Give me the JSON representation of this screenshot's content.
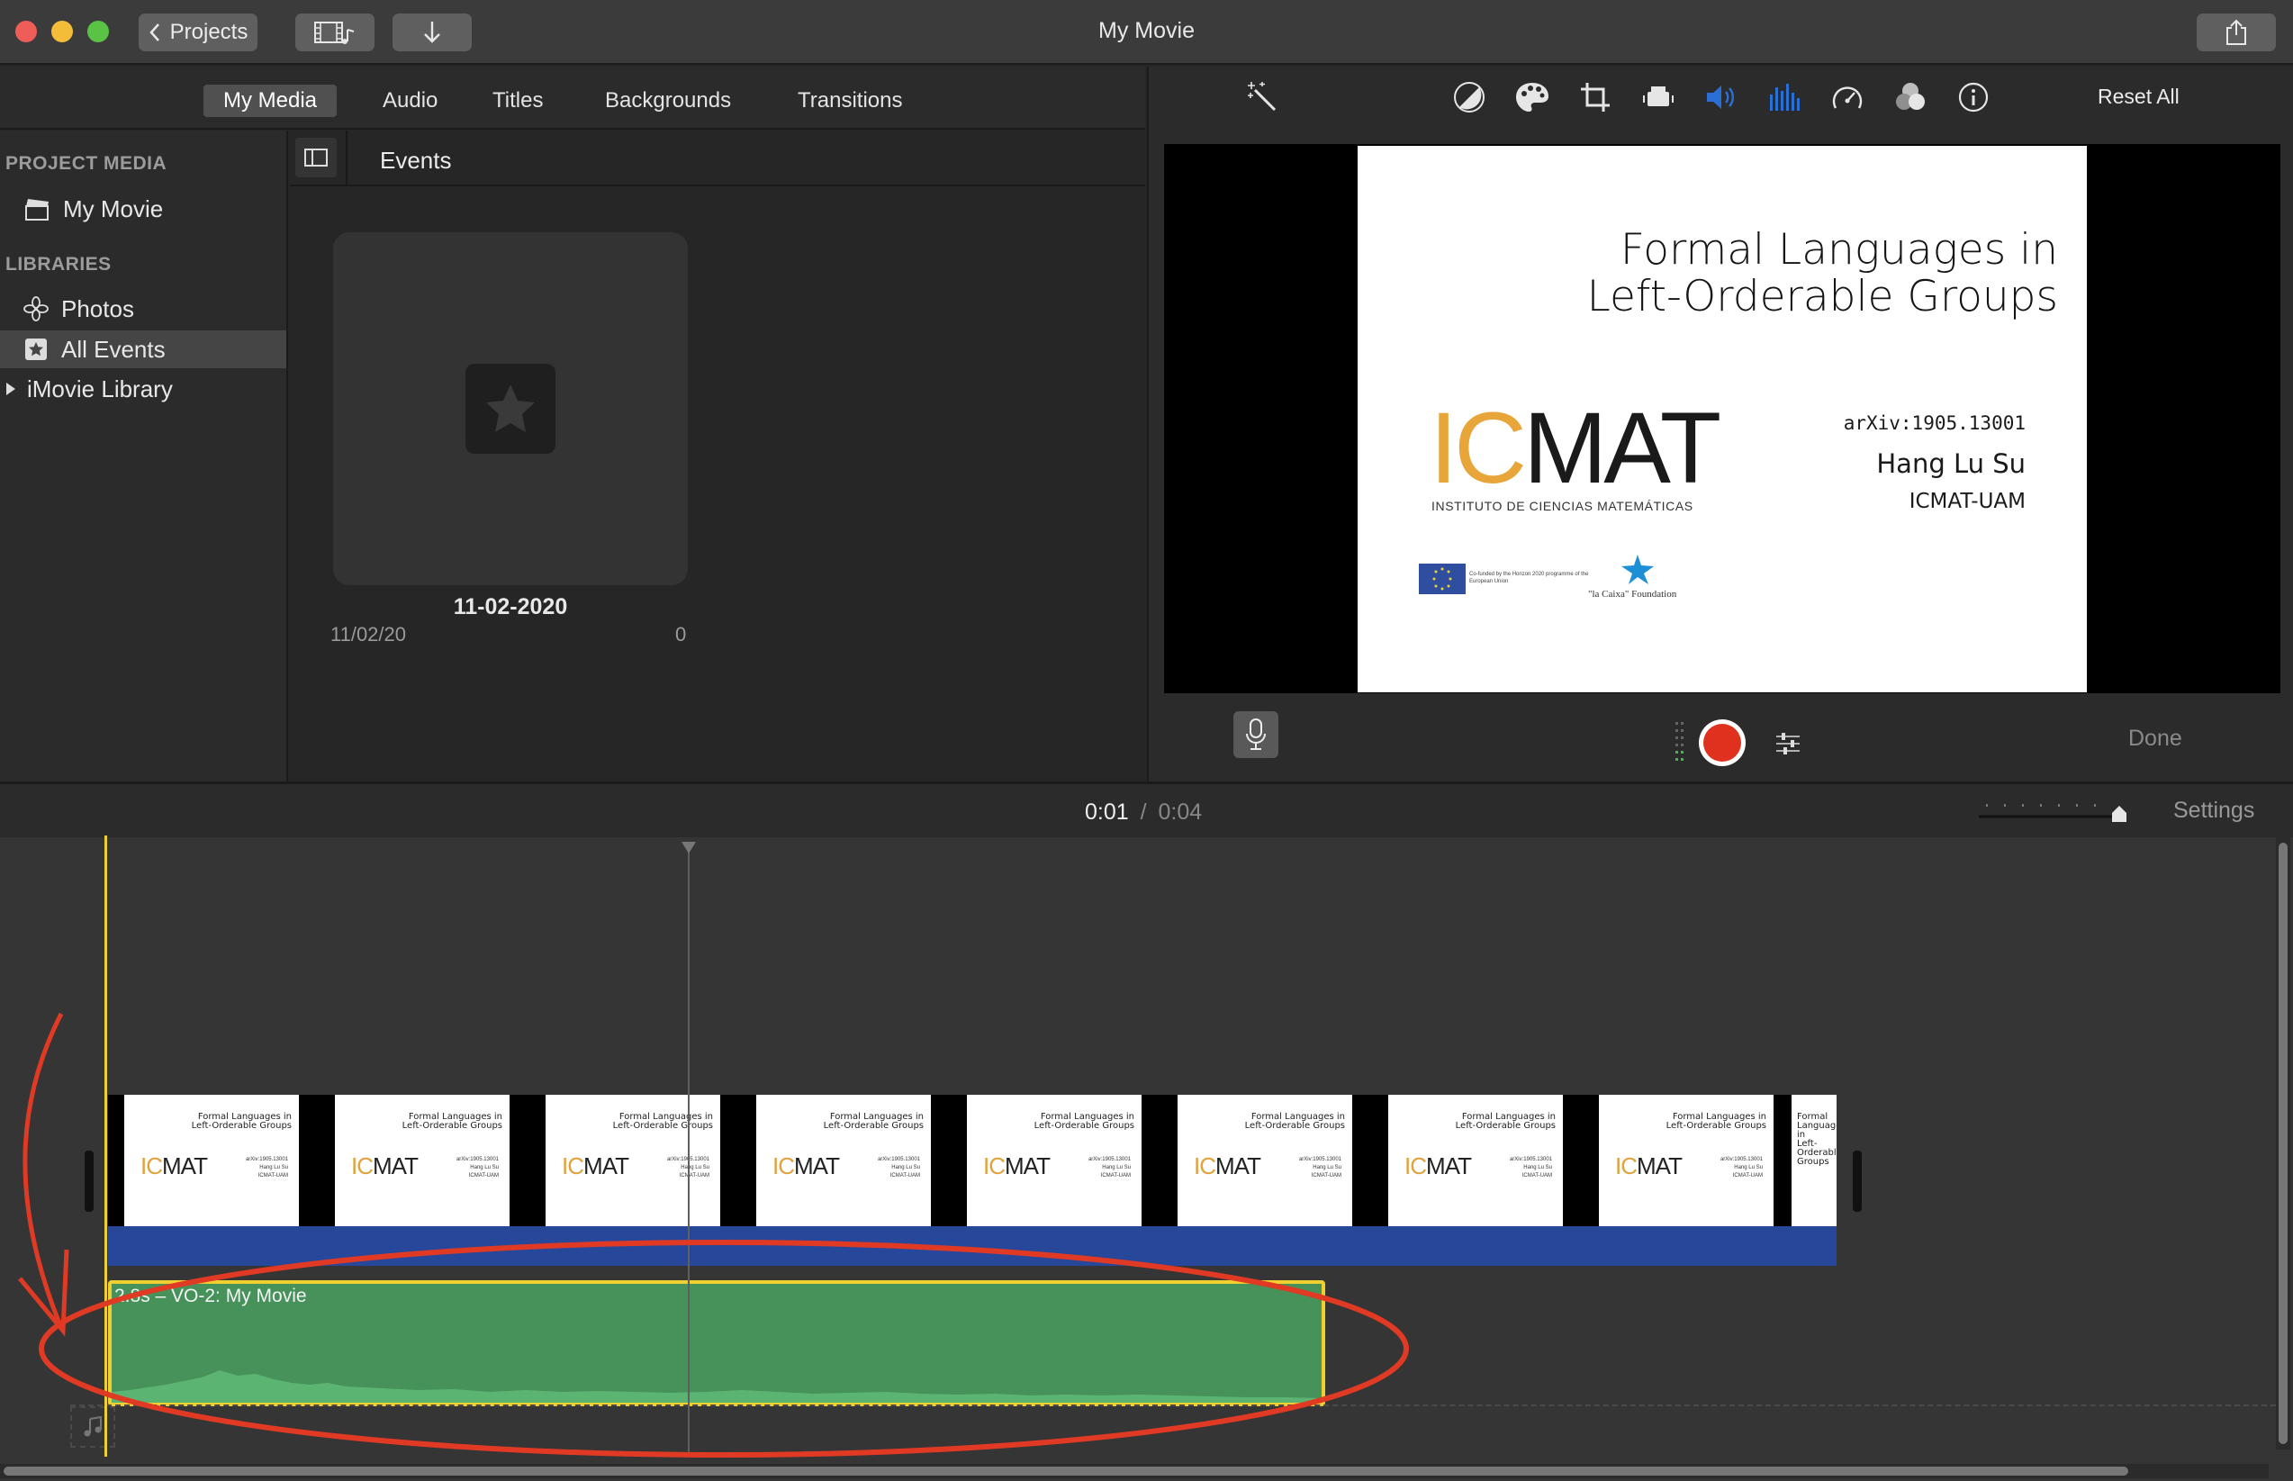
{
  "window": {
    "title": "My Movie"
  },
  "toolbar": {
    "projects_label": "Projects",
    "media_icon": "film-music-icon",
    "import_icon": "import-down-arrow-icon",
    "share_icon": "share-icon"
  },
  "media_tabs": [
    "My Media",
    "Audio",
    "Titles",
    "Backgrounds",
    "Transitions"
  ],
  "sidebar": {
    "project_media_header": "PROJECT MEDIA",
    "project_item": "My Movie",
    "libraries_header": "LIBRARIES",
    "library_items": [
      "Photos",
      "All Events",
      "iMovie Library"
    ]
  },
  "browser": {
    "header": "Events",
    "event": {
      "title": "11-02-2020",
      "date": "11/02/20",
      "count": "0"
    }
  },
  "viewer": {
    "reset_label": "Reset All",
    "done_label": "Done",
    "slide": {
      "title_line1": "Formal Languages in",
      "title_line2": "Left-Orderable Groups",
      "logo_ic": "IC",
      "logo_mat": "MAT",
      "logo_sub": "INSTITUTO DE CIENCIAS MATEMÁTICAS",
      "arxiv": "arXiv:1905.13001",
      "author": "Hang Lu Su",
      "affiliation": "ICMAT-UAM",
      "eu_text": "Co-funded by the Horizon 2020 programme of the European Union",
      "lacaixa": "\"la Caixa\" Foundation"
    }
  },
  "timeline": {
    "current_time": "0:01",
    "separator": "/",
    "total_time": "0:04",
    "settings_label": "Settings",
    "audio_clip_label": "2.8s – VO-2: My Movie"
  },
  "colors": {
    "accent_blue": "#2a6fd6",
    "record_red": "#e0301e",
    "audio_green": "#46925a",
    "clip_blue": "#26479a",
    "annotation_red": "#e03a24",
    "playhead_yellow": "#f0d030",
    "icmat_orange": "#e8a53a"
  }
}
